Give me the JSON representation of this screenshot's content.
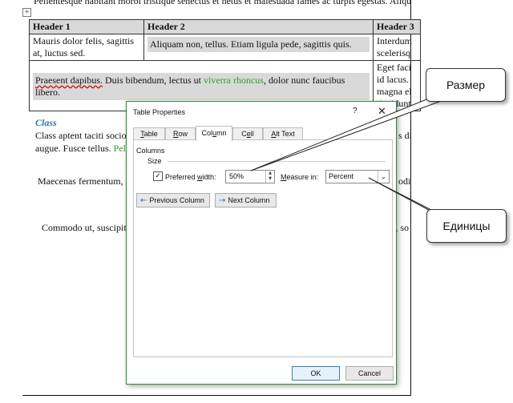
{
  "document": {
    "top_text": "Pellentesque habitant morbi tristique senectus et netus et malesuada fames ac turpis egestas. Aliquam",
    "anchor_symbol": "+",
    "table": {
      "headers": [
        "Header 1",
        "Header 2",
        "Header 3"
      ],
      "row1": {
        "c1": "Mauris dolor felis, sagittis at, luctus sed.",
        "c2": "Aliquam non, tellus. Etiam ligula pede, sagittis quis.",
        "c3a": "Interdum",
        "c3b": "scelerisq"
      },
      "row2": {
        "c1_a": "Praesent dapibus.",
        "c1_b": " Duis bibendum, lectus ut ",
        "c1_green": "viverra rhoncus",
        "c1_c": ", dolor nunc faucibus libero.",
        "c3": [
          "Eget faci",
          "id lacus.",
          "magna el",
          "tincidunt"
        ]
      }
    },
    "section_heading": "Class",
    "para1_line1_left": "Class aptent taciti socios",
    "para1_line1_right": "s di",
    "para1_line2_left": "augue. Fusce tellus. ",
    "para1_line2_green": "Pell",
    "para2_left": "Maecenas fermentum, s",
    "para2_right": "odi",
    "para3_left": "Commodo ut, suscipit",
    "para3_right": "t, so"
  },
  "dialog": {
    "title": "Table Properties",
    "help": "?",
    "close": "✕",
    "tabs": [
      "Table",
      "Row",
      "Column",
      "Cell",
      "Alt Text"
    ],
    "active_tab": "Column",
    "section_columns": "Columns",
    "section_size": "Size",
    "preferred_width_label": "Preferred width:",
    "preferred_width_checked": "✓",
    "preferred_width_value": "50%",
    "measure_in_label": "Measure in:",
    "measure_in_value": "Percent",
    "prev_column_label": "Previous Column",
    "next_column_label": "Next Column",
    "ok_label": "OK",
    "cancel_label": "Cancel"
  },
  "callouts": {
    "size": "Размер",
    "units": "Единицы"
  },
  "colors": {
    "dialog_border": "#2b8a3e",
    "heading_blue": "#2e74b5",
    "green_text": "#2e9e2e",
    "table_shade": "#d9d9d9"
  }
}
